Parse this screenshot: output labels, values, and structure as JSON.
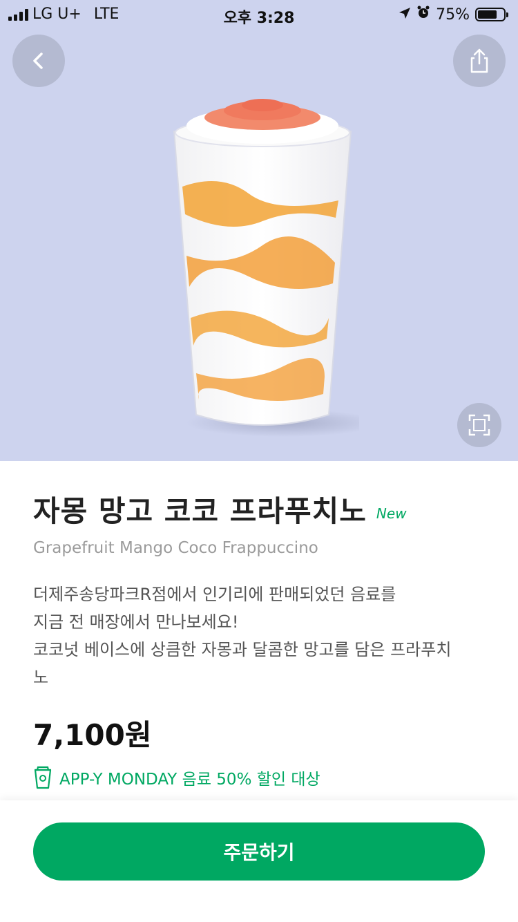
{
  "status_bar": {
    "carrier": "LG U+",
    "network": "LTE",
    "time": "오후 3:28",
    "battery": "75%",
    "battery_level": 0.75
  },
  "nav": {
    "back_icon": "chevron-left-icon",
    "share_icon": "share-icon",
    "expand_icon": "expand-icon"
  },
  "product": {
    "name": "자몽 망고 코코 프라푸치노",
    "badge": "New",
    "english_name": "Grapefruit Mango Coco Frappuccino",
    "description_lines": [
      "더제주송당파크R점에서 인기리에 판매되었던 음료를",
      "지금 전 매장에서 만나보세요!",
      "코코넛 베이스에 상큼한 자몽과 달콤한 망고를 담은 프라푸치",
      "노"
    ],
    "price": "7,100원"
  },
  "promo": {
    "icon": "cup-icon",
    "text": "APP-Y MONDAY 음료 50% 할인 대상"
  },
  "actions": {
    "order_label": "주문하기"
  },
  "colors": {
    "accent": "#00a862",
    "hero_bg": "#cdd3ee"
  }
}
